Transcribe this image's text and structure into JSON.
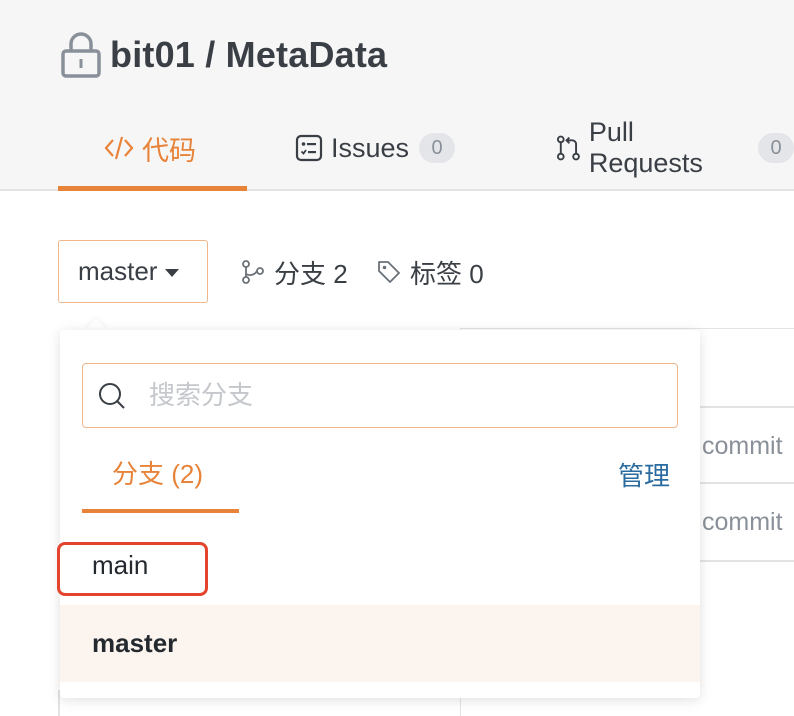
{
  "repo": {
    "owner": "bit01",
    "separator": " / ",
    "name": "MetaData",
    "full_name": "bit01 / MetaData"
  },
  "tabs": [
    {
      "label": "代码",
      "active": true,
      "icon": "code-icon"
    },
    {
      "label": "Issues",
      "count": "0",
      "icon": "issues-icon"
    },
    {
      "label": "Pull Requests",
      "count": "0",
      "icon": "pull-request-icon"
    }
  ],
  "branch_selector": {
    "current": "master"
  },
  "stats": {
    "branches_label": "分支 2",
    "tags_label": "标签 0"
  },
  "dropdown": {
    "search_placeholder": "搜索分支",
    "tab_label": "分支 (2)",
    "manage_label": "管理",
    "branches": [
      "main",
      "master"
    ],
    "selected": "master"
  },
  "background": {
    "commit_text_1": "commit",
    "commit_text_2": "commit"
  },
  "colors": {
    "accent": "#e8833a",
    "link": "#2a6ba0",
    "highlight": "#e4432d"
  }
}
